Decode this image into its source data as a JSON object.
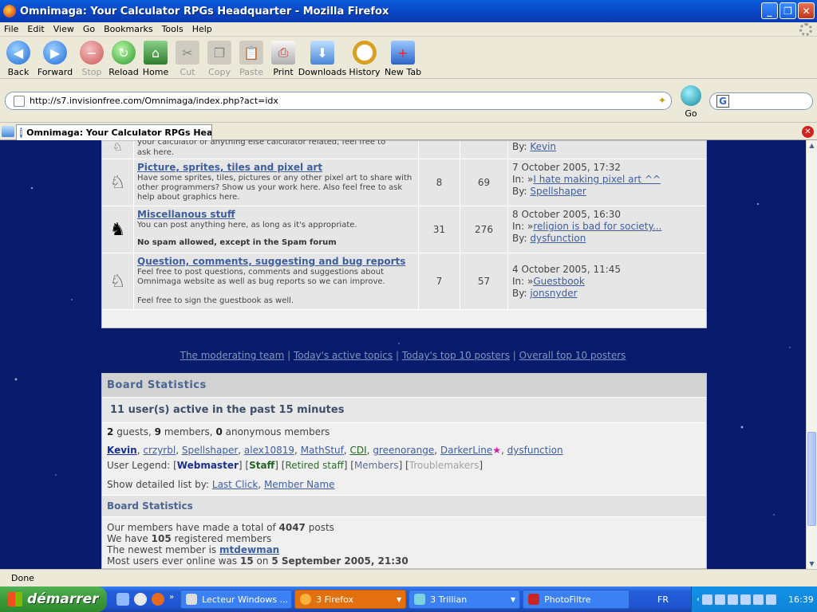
{
  "window": {
    "title": "Omnimaga: Your Calculator RPGs Headquarter - Mozilla Firefox"
  },
  "menu": {
    "file": "File",
    "edit": "Edit",
    "view": "View",
    "go": "Go",
    "bookmarks": "Bookmarks",
    "tools": "Tools",
    "help": "Help"
  },
  "toolbar": {
    "back": "Back",
    "forward": "Forward",
    "stop": "Stop",
    "reload": "Reload",
    "home": "Home",
    "cut": "Cut",
    "copy": "Copy",
    "paste": "Paste",
    "print": "Print",
    "downloads": "Downloads",
    "history": "History",
    "newtab": "New Tab"
  },
  "address": {
    "url": "http://s7.invisionfree.com/Omnimaga/index.php?act=idx",
    "go": "Go",
    "search_logo": "G"
  },
  "tab": {
    "title": "Omnimaga: Your Calculator RPGs Hea..."
  },
  "forums": {
    "partial": {
      "desc1": "your calculator or anything else calculator related, feel free to",
      "desc2": "ask here.",
      "by_label": "By:",
      "by_user": "Kevin"
    },
    "rows": [
      {
        "name": "Picture, sprites, tiles and pixel art",
        "desc": "Have some sprites, tiles, pictures or any other pixel art to share with other programmers? Show us your work here. Also feel free to ask help about graphics here.",
        "bold": "",
        "topics": "8",
        "replies": "69",
        "date": "7 October 2005, 17:32",
        "in_label": "In: »",
        "in_topic": "I hate making pixel art ^^",
        "by_label": "By:",
        "by_user": "Spellshaper"
      },
      {
        "name": "Miscellanous stuff",
        "desc": "You can post anything here, as long as it's appropriate.",
        "bold": "No spam allowed, except in the Spam forum",
        "topics": "31",
        "replies": "276",
        "date": "8 October 2005, 16:30",
        "in_label": "In: »",
        "in_topic": "religion is bad for society...",
        "by_label": "By:",
        "by_user": "dysfunction"
      },
      {
        "name": "Question, comments, suggesting and bug reports",
        "desc": "Feel free to post questions, comments and suggestions about Omnimaga website as well as bug reports so we can improve.",
        "desc2": "Feel free to sign the guestbook as well.",
        "bold": "",
        "topics": "7",
        "replies": "57",
        "date": "4 October 2005, 11:45",
        "in_label": "In: »",
        "in_topic": "Guestbook",
        "by_label": "By:",
        "by_user": "jonsnyder"
      }
    ]
  },
  "footer_links": [
    "The moderating team",
    "Today's active topics",
    "Today's top 10 posters",
    "Overall top 10 posters"
  ],
  "stats": {
    "title": "Board Statistics",
    "active_header": "11 user(s) active in the past 15 minutes",
    "guests": "2",
    "guests_label": "guests,",
    "members": "9",
    "members_label": "members,",
    "anon": "0",
    "anon_label": "anonymous members",
    "users": [
      "crzyrbl",
      "Spellshaper",
      "alex10819",
      "MathStuf",
      "CDI",
      "greenorange",
      "DarkerLine",
      "dysfunction"
    ],
    "first_user": "Kevin",
    "legend_label": "User Legend:",
    "legend": {
      "webmaster": "Webmaster",
      "staff": "Staff",
      "retired": "Retired staff",
      "members": "Members",
      "trouble": "Troublemakers"
    },
    "detail_label": "Show detailed list by:",
    "detail_lastclick": "Last Click",
    "detail_name": "Member Name",
    "sub_title": "Board Statistics",
    "posts_pre": "Our members have made a total of",
    "posts": "4047",
    "posts_post": "posts",
    "reg_pre": "We have",
    "reg": "105",
    "reg_post": "registered members",
    "newest_pre": "The newest member is",
    "newest": "mtdewman",
    "most_pre": "Most users ever online was",
    "most": "15",
    "most_on": "on",
    "most_date": "5 September 2005, 21:30"
  },
  "status": {
    "text": "Done"
  },
  "taskbar": {
    "start": "démarrer",
    "items": [
      "Lecteur Windows ...",
      "3 Firefox",
      "3 Trillian",
      "PhotoFiltre"
    ],
    "lang": "FR",
    "clock": "16:39"
  }
}
